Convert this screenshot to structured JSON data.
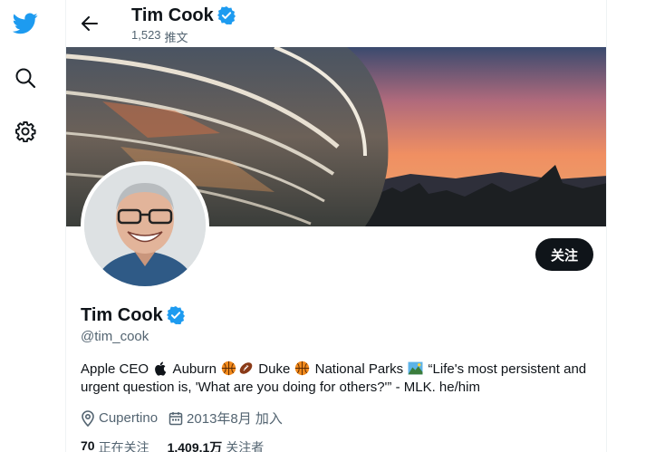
{
  "nav": {
    "icons": [
      "twitter-bird-icon",
      "search-icon",
      "gear-icon"
    ]
  },
  "header": {
    "name": "Tim Cook",
    "tweet_count": "1,523",
    "tweet_label": "推文"
  },
  "profile": {
    "name": "Tim Cook",
    "handle": "@tim_cook",
    "follow_label": "关注",
    "bio": {
      "part1": "Apple CEO ",
      "part2": " Auburn ",
      "part3": " Duke ",
      "part4": " National Parks ",
      "part5": " “Life's most persistent and urgent question is, 'What are you doing for others?'” - MLK. he/him"
    },
    "location": "Cupertino",
    "joined": "2013年8月 加入",
    "following_count": "70",
    "following_label": "正在关注",
    "followers_count": "1,409.1万",
    "followers_label": "关注者"
  },
  "colors": {
    "brand": "#1d9bf0",
    "text": "#0f1419",
    "secondary": "#536471",
    "button": "#0f1419"
  }
}
